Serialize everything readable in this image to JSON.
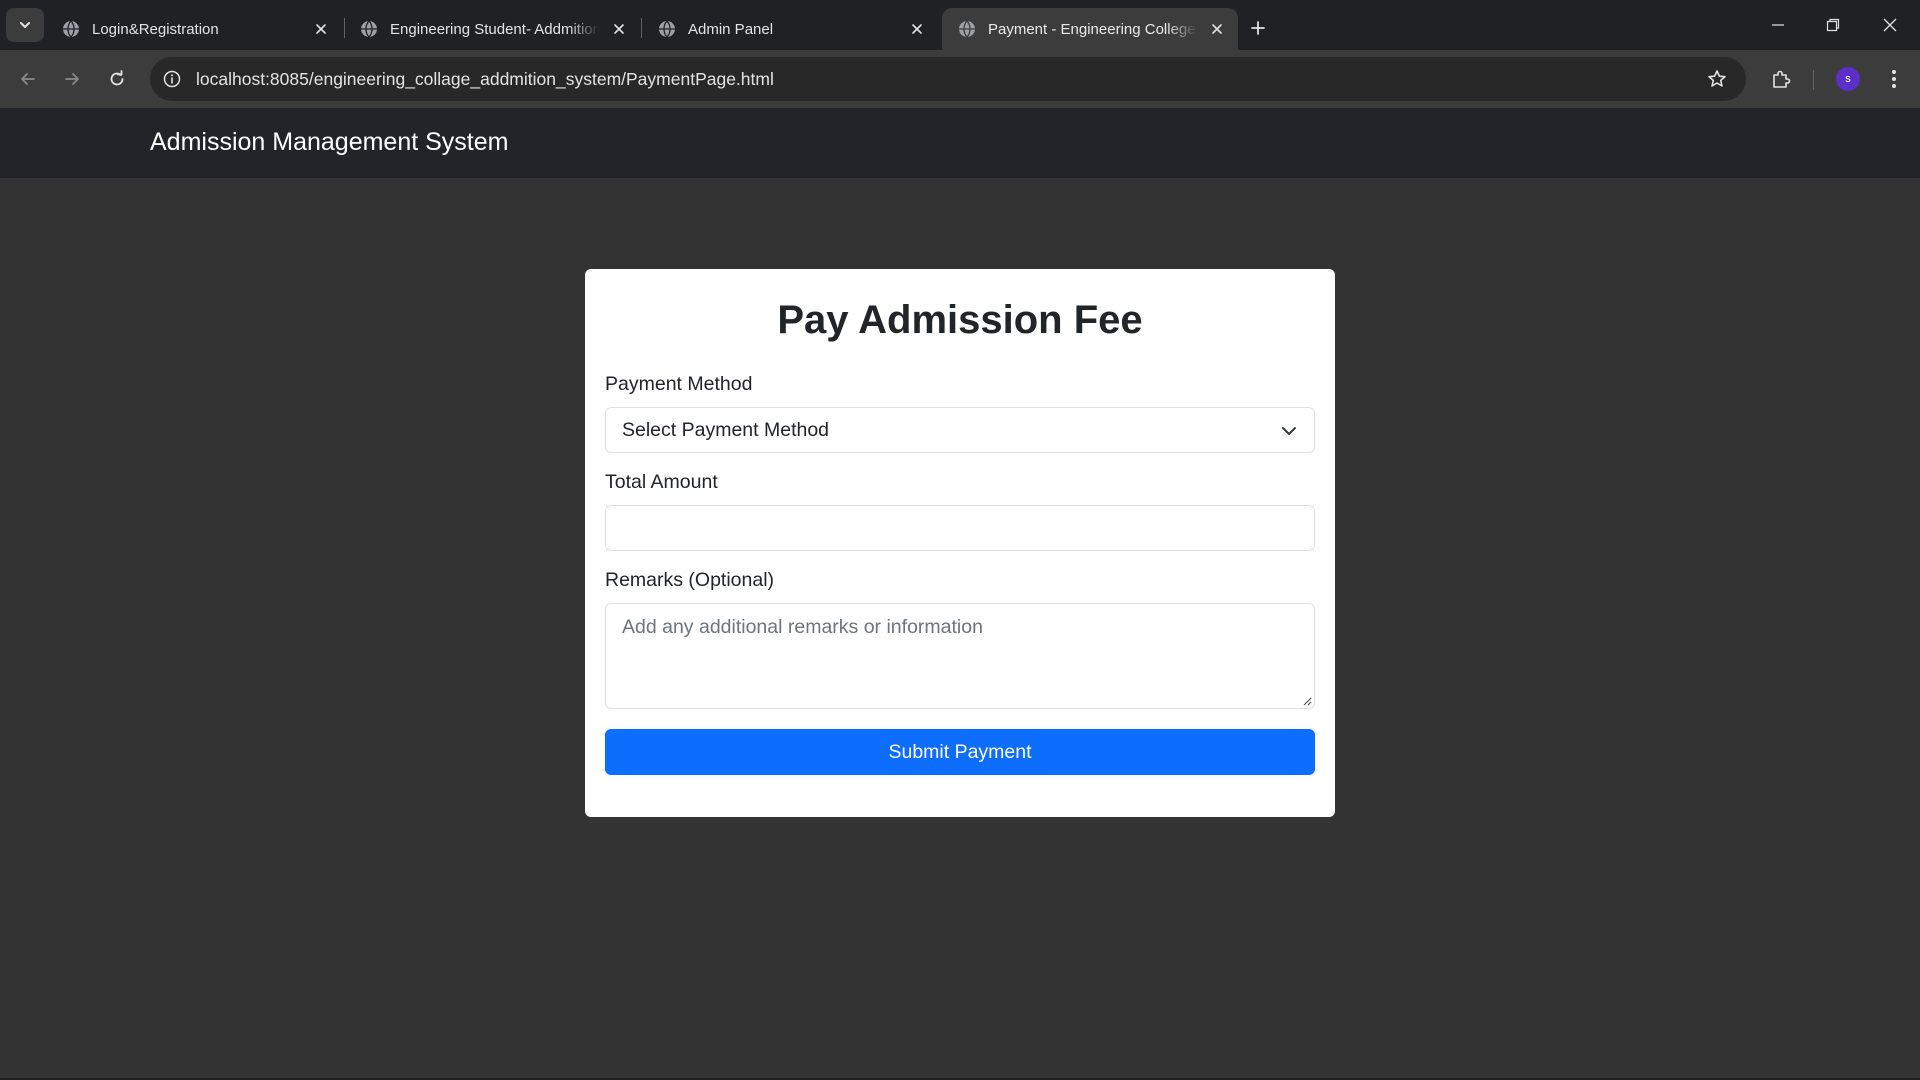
{
  "browser": {
    "tabs": [
      {
        "title": "Login&Registration",
        "active": false
      },
      {
        "title": "Engineering Student- Addmition",
        "active": false
      },
      {
        "title": "Admin Panel",
        "active": false
      },
      {
        "title": "Payment - Engineering College",
        "active": true
      }
    ],
    "url": "localhost:8085/engineering_collage_addmition_system/PaymentPage.html",
    "profile_initial": "s",
    "icons": {
      "tab_search": "chevron-down-icon",
      "favicon": "globe-icon",
      "close": "close-icon",
      "new_tab": "plus-icon",
      "back": "arrow-left-icon",
      "forward": "arrow-right-icon",
      "reload": "reload-icon",
      "site_info": "info-icon",
      "bookmark": "star-icon",
      "extensions": "puzzle-icon",
      "menu": "more-vert-icon"
    },
    "colors": {
      "chrome_bg": "#202124",
      "toolbar_bg": "#3c3c3c",
      "avatar": "#5b2fc9"
    }
  },
  "page": {
    "brand": "Admission Management System",
    "form": {
      "title": "Pay Admission Fee",
      "payment_method_label": "Payment Method",
      "payment_method_value": "Select Payment Method",
      "total_amount_label": "Total Amount",
      "total_amount_value": "",
      "remarks_label": "Remarks (Optional)",
      "remarks_placeholder": "Add any additional remarks or information",
      "submit_label": "Submit Payment"
    },
    "colors": {
      "navbar": "#212529",
      "background": "#333333",
      "primary": "#0d6efd"
    }
  }
}
